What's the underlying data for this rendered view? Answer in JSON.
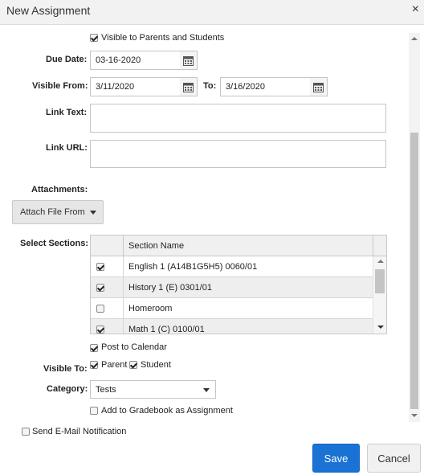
{
  "dialog": {
    "title": "New Assignment",
    "close_glyph": "×"
  },
  "visible_parents_students": {
    "label": "Visible to Parents and Students",
    "checked": true
  },
  "due_date": {
    "label": "Due Date:",
    "value": "03-16-2020"
  },
  "visible_from": {
    "label": "Visible From:",
    "value": "3/11/2020",
    "to_label": "To:",
    "to_value": "3/16/2020"
  },
  "link_text": {
    "label": "Link Text:",
    "value": ""
  },
  "link_url": {
    "label": "Link URL:",
    "value": ""
  },
  "attachments": {
    "label": "Attachments:",
    "button_label": "Attach File From"
  },
  "sections": {
    "label": "Select Sections:",
    "column_header": "Section Name",
    "rows": [
      {
        "name": "English 1 (A14B1G5H5) 0060/01",
        "checked": true
      },
      {
        "name": "History 1 (E) 0301/01",
        "checked": true
      },
      {
        "name": "Homeroom",
        "checked": false
      },
      {
        "name": "Math 1 (C) 0100/01",
        "checked": true
      }
    ]
  },
  "post_to_calendar": {
    "label": "Post to Calendar",
    "checked": true
  },
  "visible_to": {
    "label": "Visible To:",
    "parent": {
      "label": "Parent",
      "checked": true
    },
    "student": {
      "label": "Student",
      "checked": true
    }
  },
  "category": {
    "label": "Category:",
    "value": "Tests"
  },
  "add_to_gradebook": {
    "label": "Add to Gradebook as Assignment",
    "checked": false
  },
  "send_email": {
    "label": "Send E-Mail Notification",
    "checked": false
  },
  "footer": {
    "save_label": "Save",
    "cancel_label": "Cancel"
  },
  "colors": {
    "primary": "#1a73d4",
    "title_bar": "#f2f2f2",
    "row_alt": "#eeeeee"
  },
  "icons": [
    "close-icon",
    "calendar-icon",
    "chevron-down-icon",
    "check-icon"
  ]
}
